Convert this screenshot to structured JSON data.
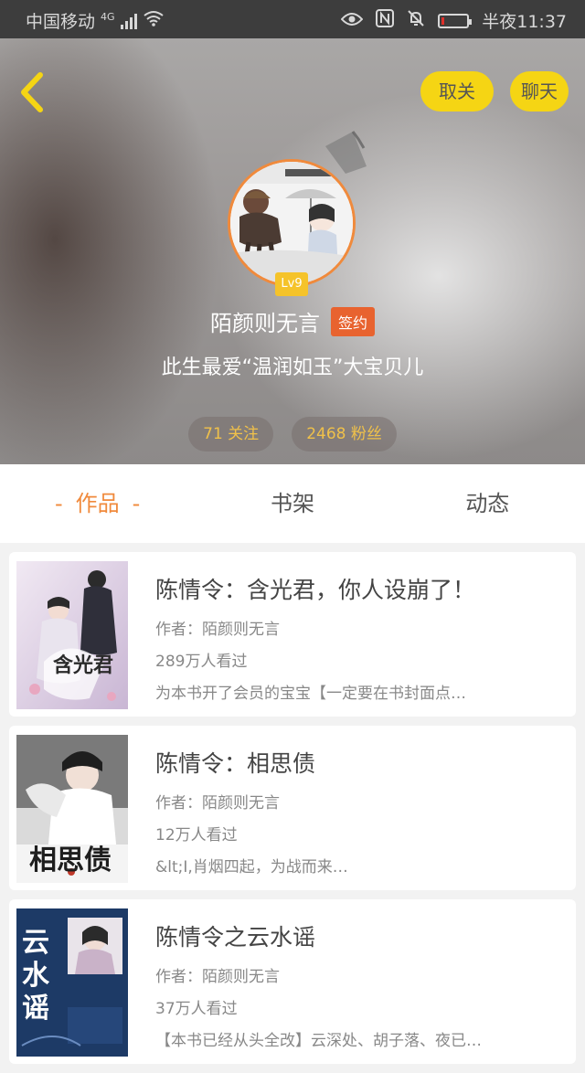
{
  "status_bar": {
    "carrier": "中国移动",
    "network": "4G",
    "time": "半夜11:37",
    "icons": [
      "signal-icon",
      "wifi-icon",
      "eye-icon",
      "nfc-icon",
      "mute-icon",
      "battery-icon"
    ],
    "battery_level": 0.12
  },
  "header": {
    "follow_state_label": "取关",
    "chat_label": "聊天",
    "level": "Lv9",
    "username": "陌颜则无言",
    "signed_badge": "签约",
    "bio": "此生最爱“温润如玉”大宝贝儿",
    "following": "71 关注",
    "followers": "2468 粉丝"
  },
  "tabs": [
    {
      "label": "作品",
      "active": true
    },
    {
      "label": "书架",
      "active": false
    },
    {
      "label": "动态",
      "active": false
    }
  ],
  "books": [
    {
      "title": "陈情令：含光君，你人设崩了！",
      "author": "作者：陌颜则无言",
      "views": "289万人看过",
      "desc": "为本书开了会员的宝宝【一定要在书封面点…",
      "cover_text": "含光君"
    },
    {
      "title": "陈情令：相思债",
      "author": "作者：陌颜则无言",
      "views": "12万人看过",
      "desc": "&lt;I,肖烟四起，为战而来…",
      "cover_text": "相思债"
    },
    {
      "title": "陈情令之云水谣",
      "author": "作者：陌颜则无言",
      "views": "37万人看过",
      "desc": "【本书已经从头全改】云深处、胡子落、夜已…",
      "cover_text": "云水谣"
    }
  ],
  "colors": {
    "accent": "#f08a3c",
    "button_yellow": "#f5d514",
    "signed_orange": "#e8632f",
    "stat_text": "#f0c14a"
  }
}
